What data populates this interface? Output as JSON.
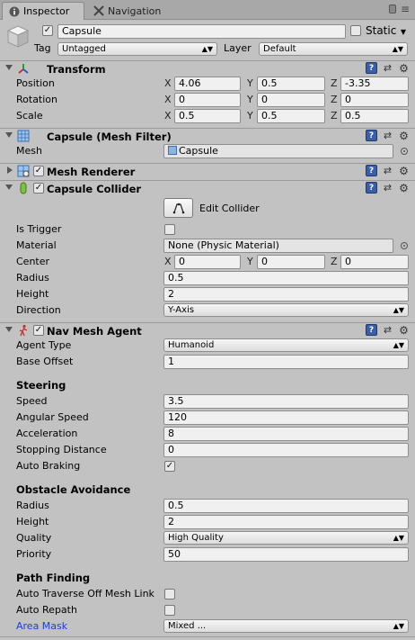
{
  "tabs": [
    {
      "label": "Inspector",
      "icon": "info-icon"
    },
    {
      "label": "Navigation",
      "icon": "navigation-icon"
    }
  ],
  "header": {
    "object_name": "Capsule",
    "active_checked": true,
    "static_label": "Static",
    "static_checked": false,
    "tag_label": "Tag",
    "tag_value": "Untagged",
    "layer_label": "Layer",
    "layer_value": "Default"
  },
  "transform": {
    "title": "Transform",
    "position_label": "Position",
    "rotation_label": "Rotation",
    "scale_label": "Scale",
    "axis_x": "X",
    "axis_y": "Y",
    "axis_z": "Z",
    "position": {
      "x": "4.06",
      "y": "0.5",
      "z": "-3.35"
    },
    "rotation": {
      "x": "0",
      "y": "0",
      "z": "0"
    },
    "scale": {
      "x": "0.5",
      "y": "0.5",
      "z": "0.5"
    }
  },
  "mesh_filter": {
    "title": "Capsule (Mesh Filter)",
    "mesh_label": "Mesh",
    "mesh_value": "Capsule"
  },
  "mesh_renderer": {
    "title": "Mesh Renderer",
    "enabled": true
  },
  "capsule_collider": {
    "title": "Capsule Collider",
    "enabled": true,
    "edit_label": "Edit Collider",
    "is_trigger_label": "Is Trigger",
    "is_trigger": false,
    "material_label": "Material",
    "material_value": "None (Physic Material)",
    "center_label": "Center",
    "center": {
      "x": "0",
      "y": "0",
      "z": "0"
    },
    "radius_label": "Radius",
    "radius_value": "0.5",
    "height_label": "Height",
    "height_value": "2",
    "direction_label": "Direction",
    "direction_value": "Y-Axis"
  },
  "nav_mesh_agent": {
    "title": "Nav Mesh Agent",
    "enabled": true,
    "agent_type_label": "Agent Type",
    "agent_type_value": "Humanoid",
    "base_offset_label": "Base Offset",
    "base_offset_value": "1",
    "steering_title": "Steering",
    "speed_label": "Speed",
    "speed_value": "3.5",
    "angular_speed_label": "Angular Speed",
    "angular_speed_value": "120",
    "acceleration_label": "Acceleration",
    "acceleration_value": "8",
    "stopping_distance_label": "Stopping Distance",
    "stopping_distance_value": "0",
    "auto_braking_label": "Auto Braking",
    "auto_braking": true,
    "obstacle_title": "Obstacle Avoidance",
    "radius_label": "Radius",
    "radius_value": "0.5",
    "height_label": "Height",
    "height_value": "2",
    "quality_label": "Quality",
    "quality_value": "High Quality",
    "priority_label": "Priority",
    "priority_value": "50",
    "pathfinding_title": "Path Finding",
    "auto_traverse_label": "Auto Traverse Off Mesh Link",
    "auto_traverse": false,
    "auto_repath_label": "Auto Repath",
    "auto_repath": false,
    "area_mask_label": "Area Mask",
    "area_mask_value": "Mixed ..."
  },
  "check_glyph": "✓",
  "colors": {
    "panel": "#c2c2c2",
    "help_blue": "#3b5ea8",
    "area_mask_label": "#1a3fd8"
  }
}
